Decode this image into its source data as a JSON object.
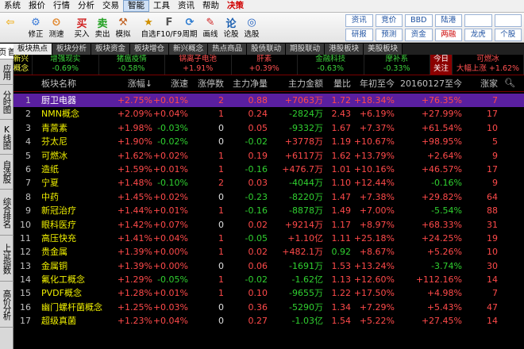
{
  "menu": [
    "系统",
    "报价",
    "行情",
    "分析",
    "交易",
    "智能",
    "工具",
    "资讯",
    "帮助",
    "决策"
  ],
  "toolbar": [
    {
      "icon": "back-arrow-icon",
      "label": ""
    },
    {
      "icon": "settings-icon",
      "label": "修正"
    },
    {
      "icon": "test-icon",
      "label": "测速"
    },
    {
      "icon": "buy-icon",
      "label": "买入",
      "glyph": "买"
    },
    {
      "icon": "sell-icon",
      "label": "卖出",
      "glyph": "卖"
    },
    {
      "icon": "hammer-icon",
      "label": "模拟"
    },
    {
      "icon": "star-icon",
      "label": "自选"
    },
    {
      "icon": "f10-icon",
      "label": "F10/F9"
    },
    {
      "icon": "cycle-icon",
      "label": "周期"
    },
    {
      "icon": "pen-icon",
      "label": "画线"
    },
    {
      "icon": "stock-forum-icon",
      "label": "论股",
      "glyph": "论"
    },
    {
      "icon": "pick-stock-icon",
      "label": "选股"
    }
  ],
  "toolbar_right": [
    {
      "label": "资讯",
      "red": false
    },
    {
      "label": "竞价",
      "red": false
    },
    {
      "label": "BBD",
      "red": false
    },
    {
      "label": "陆港",
      "red": false
    },
    {
      "label": "",
      "red": false
    },
    {
      "label": "",
      "red": false
    },
    {
      "label": "研报",
      "red": false
    },
    {
      "label": "预测",
      "red": false
    },
    {
      "label": "资金",
      "red": false
    },
    {
      "label": "两融",
      "red": true
    },
    {
      "label": "龙虎",
      "red": false
    },
    {
      "label": "个股",
      "red": false
    }
  ],
  "sidebar": [
    "首页",
    "应用",
    "分时图",
    "K线图",
    "自选股",
    "综合排名",
    "上证指数",
    "高价分析"
  ],
  "tabs": [
    "板块热点",
    "板块分析",
    "板块资金",
    "板块增仓",
    "新兴概念",
    "热点商品",
    "股债联动",
    "期股联动",
    "港股板块",
    "美股板块"
  ],
  "tickers": {
    "lead": "新兴概念",
    "items": [
      {
        "name": "增强现实",
        "value": "-0.69%",
        "name_green": true,
        "value_green": true
      },
      {
        "name": "猪瘟疫情",
        "value": "-0.58%",
        "name_green": true,
        "value_green": true
      },
      {
        "name": "锅离子电池",
        "value": "+1.91%",
        "name_green": false,
        "value_green": false
      },
      {
        "name": "肝素",
        "value": "+0.39%",
        "name_green": false,
        "value_green": false
      },
      {
        "name": "金融科技",
        "value": "-0.63%",
        "name_green": true,
        "value_green": true
      },
      {
        "name": "摩补系",
        "value": "-0.33%",
        "name_green": true,
        "value_green": true
      }
    ],
    "focus": "今日关注",
    "tail": {
      "name": "可燃冰",
      "value": "大幅上涨 +1.62%"
    }
  },
  "table": {
    "headers": [
      "",
      "板块名称",
      "涨幅↓",
      "涨速",
      "涨停数",
      "主力净量",
      "主力金额",
      "量比",
      "年初至今",
      "20160127至今",
      "涨家"
    ],
    "rows": [
      [
        "1",
        "厨卫电器",
        "+2.75%",
        "+0.01%",
        "2",
        "0.88",
        "+7063万",
        "1.72",
        "+18.34%",
        "+76.35%",
        "7"
      ],
      [
        "2",
        "NMN概念",
        "+2.09%",
        "+0.04%",
        "1",
        "0.24",
        "-2824万",
        "2.43",
        "+6.19%",
        "+27.99%",
        "17"
      ],
      [
        "3",
        "青蒿素",
        "+1.98%",
        "-0.03%",
        "0",
        "0.05",
        "-9332万",
        "1.67",
        "+7.37%",
        "+61.54%",
        "10"
      ],
      [
        "4",
        "芬太尼",
        "+1.90%",
        "-0.02%",
        "0",
        "-0.02",
        "+3778万",
        "1.19",
        "+10.67%",
        "+98.95%",
        "5"
      ],
      [
        "5",
        "可燃冰",
        "+1.62%",
        "+0.02%",
        "1",
        "0.19",
        "+6117万",
        "1.62",
        "+13.79%",
        "+2.64%",
        "9"
      ],
      [
        "6",
        "造纸",
        "+1.59%",
        "+0.01%",
        "1",
        "-0.16",
        "+476.7万",
        "1.01",
        "+10.16%",
        "+46.57%",
        "17"
      ],
      [
        "7",
        "宁夏",
        "+1.48%",
        "-0.10%",
        "2",
        "0.03",
        "-4044万",
        "1.10",
        "+12.44%",
        "-0.16%",
        "9"
      ],
      [
        "8",
        "中药",
        "+1.45%",
        "+0.02%",
        "0",
        "-0.23",
        "-8220万",
        "1.47",
        "+7.38%",
        "+29.82%",
        "64"
      ],
      [
        "9",
        "新冠治疗",
        "+1.44%",
        "+0.01%",
        "1",
        "-0.16",
        "-8878万",
        "1.49",
        "+7.00%",
        "-5.54%",
        "88"
      ],
      [
        "10",
        "眼科医疗",
        "+1.42%",
        "+0.07%",
        "0",
        "0.02",
        "+9214万",
        "1.17",
        "+8.97%",
        "+68.33%",
        "31"
      ],
      [
        "11",
        "高压快充",
        "+1.41%",
        "+0.04%",
        "1",
        "-0.05",
        "+1.10亿",
        "1.11",
        "+25.18%",
        "+24.25%",
        "19"
      ],
      [
        "12",
        "贵金属",
        "+1.39%",
        "+0.00%",
        "1",
        "0.02",
        "+482.1万",
        "0.92",
        "+8.67%",
        "+5.26%",
        "10"
      ],
      [
        "13",
        "金属铜",
        "+1.39%",
        "+0.00%",
        "0",
        "0.06",
        "-1691万",
        "1.53",
        "+13.24%",
        "-3.74%",
        "30"
      ],
      [
        "14",
        "氟化工概念",
        "+1.29%",
        "-0.05%",
        "1",
        "-0.02",
        "-1.62亿",
        "1.13",
        "+12.60%",
        "+112.16%",
        "14"
      ],
      [
        "15",
        "PVDF概念",
        "+1.28%",
        "+0.01%",
        "1",
        "0.10",
        "-9655万",
        "1.22",
        "+17.50%",
        "+4.98%",
        "7"
      ],
      [
        "16",
        "幽门螺杆菌概念",
        "+1.25%",
        "+0.03%",
        "0",
        "0.36",
        "-5290万",
        "1.34",
        "+7.29%",
        "+5.43%",
        "47"
      ],
      [
        "17",
        "超级真菌",
        "+1.23%",
        "+0.04%",
        "0",
        "0.27",
        "-1.03亿",
        "1.54",
        "+5.22%",
        "+27.45%",
        "14"
      ]
    ]
  },
  "colors": {
    "up": "#ff4a4a",
    "down": "#30d030",
    "name": "#f0f000",
    "selected_row": "#5a1fa0",
    "background": "#000000"
  }
}
